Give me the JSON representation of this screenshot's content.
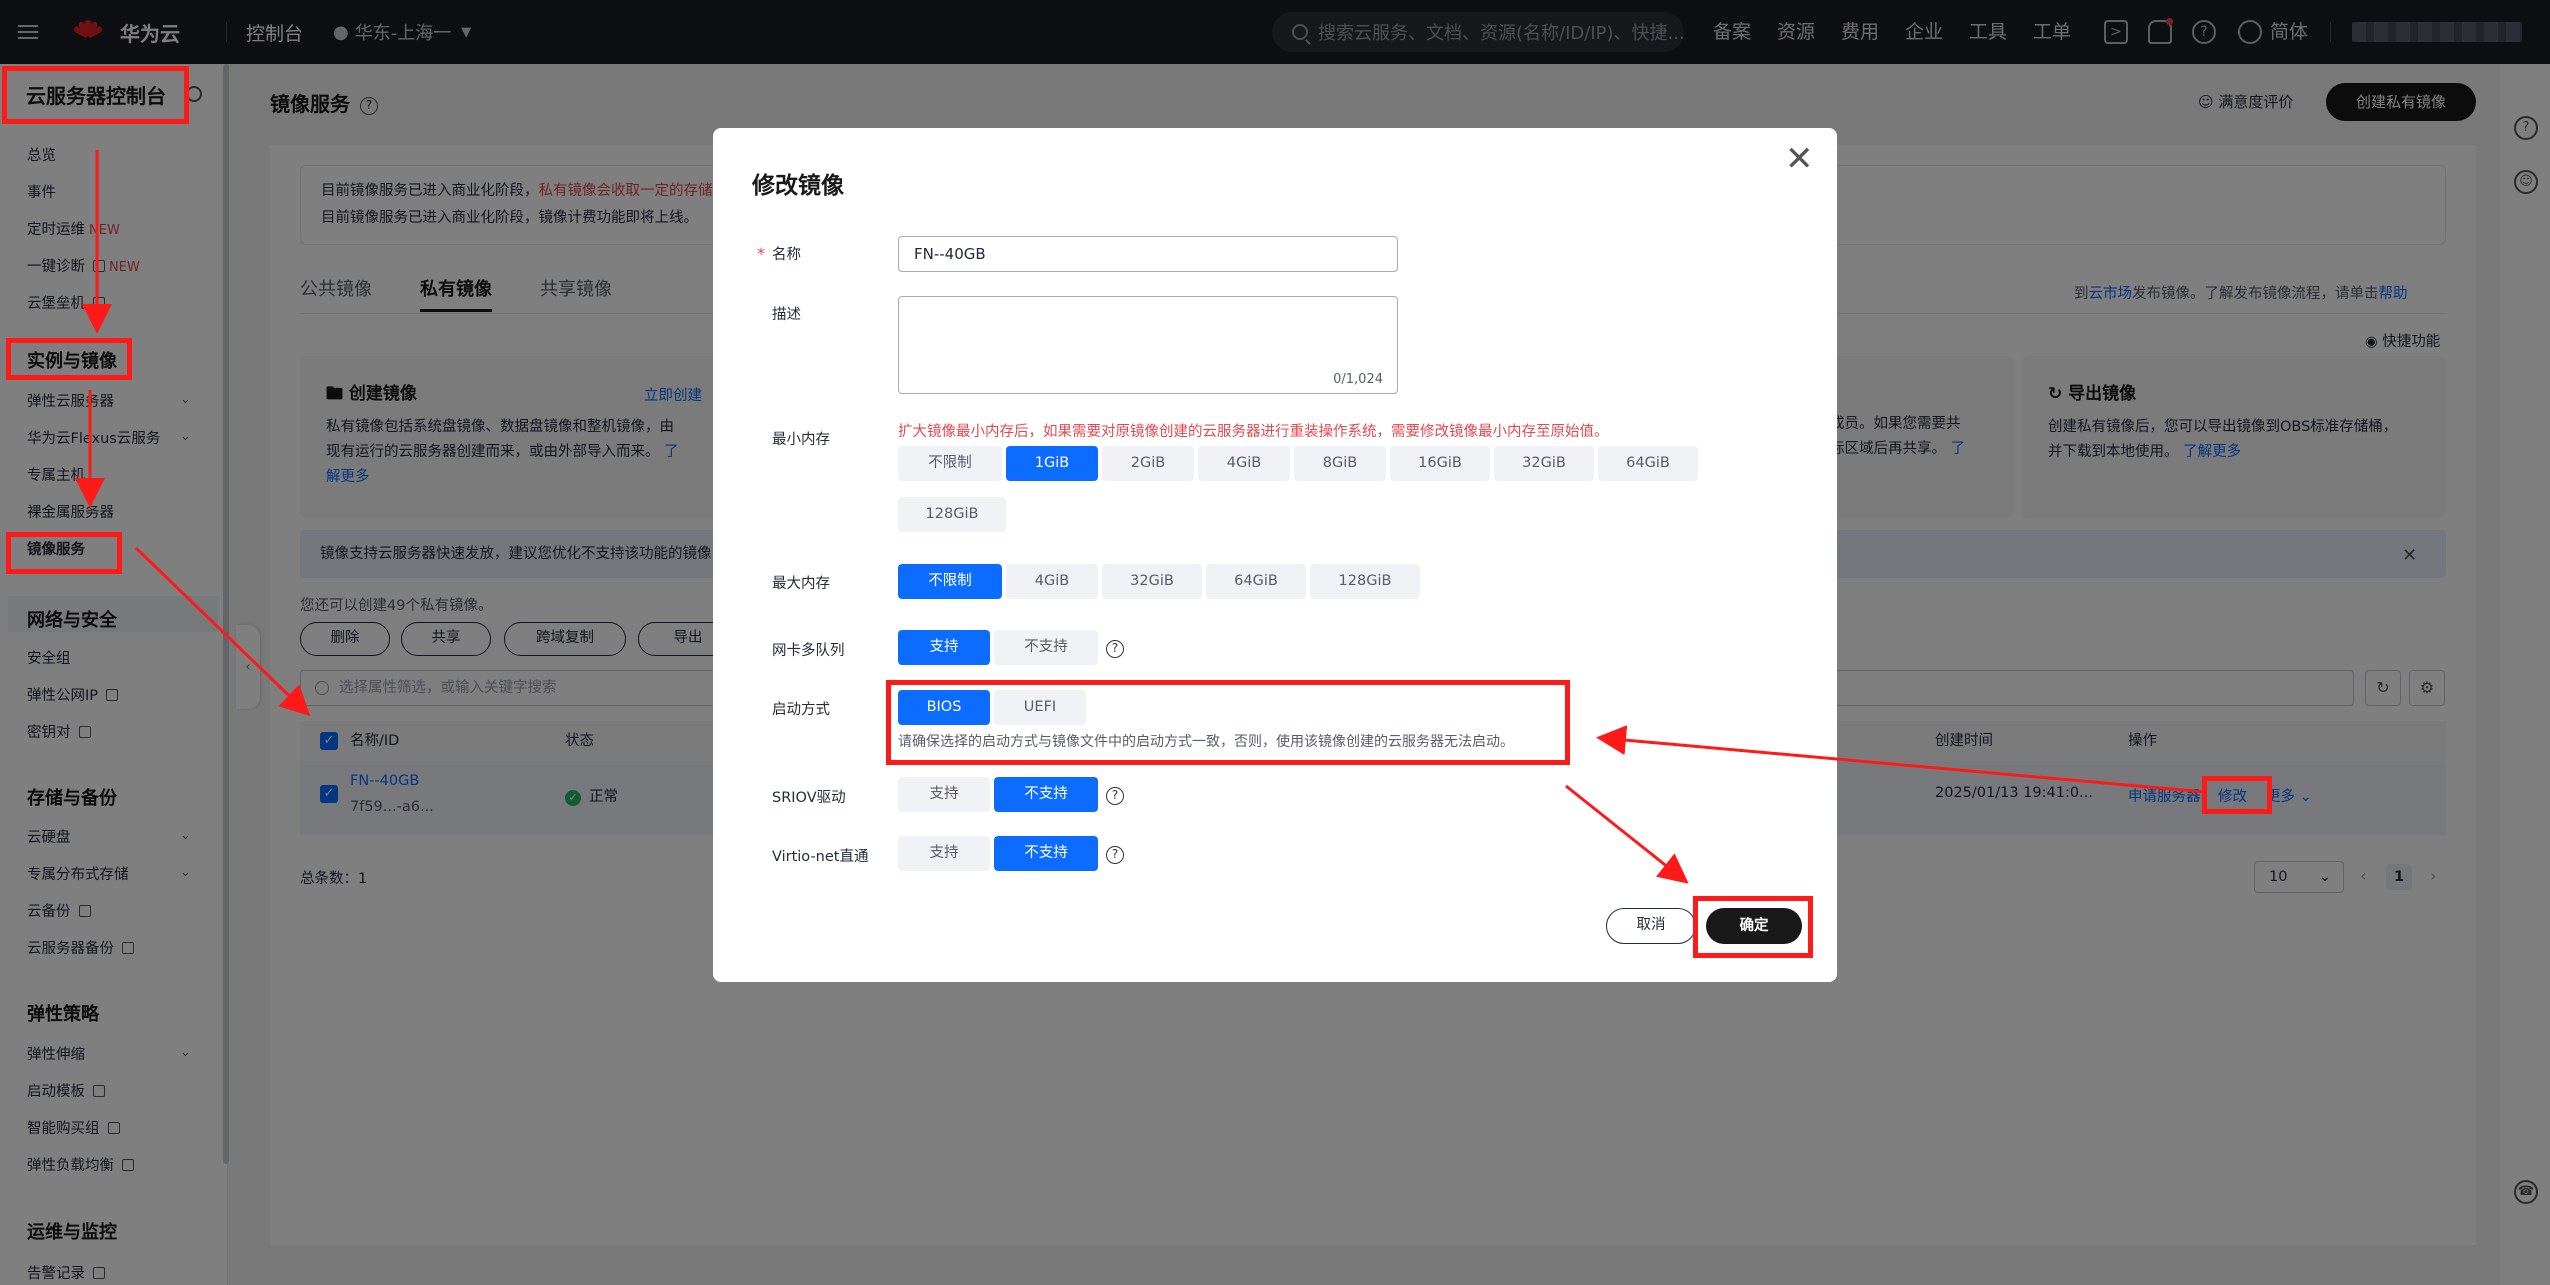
{
  "topbar": {
    "brand": "华为云",
    "console": "控制台",
    "region": "华东-上海一",
    "search_placeholder": "搜索云服务、文档、资源(名称/ID/IP)、快捷...",
    "nav": [
      "备案",
      "资源",
      "费用",
      "企业",
      "工具",
      "工单"
    ],
    "lang": "简体"
  },
  "sidebar": {
    "title": "云服务器控制台",
    "items_top": [
      {
        "label": "总览"
      },
      {
        "label": "事件"
      },
      {
        "label": "定时运维",
        "badge": "NEW"
      },
      {
        "label": "一键诊断",
        "badge": "NEW"
      },
      {
        "label": "云堡垒机"
      }
    ],
    "groups": [
      {
        "title": "实例与镜像",
        "items": [
          "弹性云服务器",
          "华为云Flexus云服务",
          "专属主机",
          "裸金属服务器",
          "镜像服务"
        ]
      },
      {
        "title": "网络与安全",
        "items": [
          "安全组",
          "弹性公网IP",
          "密钥对"
        ]
      },
      {
        "title": "存储与备份",
        "items": [
          "云硬盘",
          "专属分布式存储",
          "云备份",
          "云服务器备份"
        ]
      },
      {
        "title": "弹性策略",
        "items": [
          "弹性伸缩",
          "启动模板",
          "智能购买组",
          "弹性负载均衡"
        ]
      },
      {
        "title": "运维与监控",
        "items": [
          "告警记录"
        ]
      }
    ]
  },
  "page": {
    "title": "镜像服务",
    "survey": "满意度评价",
    "create_button": "创建私有镜像",
    "notice_line1_a": "目前镜像服务已进入商业化阶段，",
    "notice_line1_b": "私有镜像会收取一定的存储",
    "notice_line2": "目前镜像服务已进入商业化阶段，镜像计费功能即将上线。",
    "tabs": [
      "公共镜像",
      "私有镜像",
      "共享镜像"
    ],
    "tabs_right_a": "到",
    "tabs_right_link": "云市场",
    "tabs_right_b": "发布镜像。了解发布镜像流程，请单击",
    "tabs_right_help": "帮助",
    "quick": "快捷功能",
    "card_create": {
      "title": "创建镜像",
      "link": "立即创建",
      "text1": "私有镜像包括系统盘镜像、数据盘镜像和整机镜像，由",
      "text2": "现有运行的云服务器创建而来，或由外部导入而来。",
      "text3": "解更多",
      "link2": "了"
    },
    "card_share": {
      "text1": "成员。如果您需要共",
      "text2": "标区域后再共享。",
      "link": "了"
    },
    "card_export": {
      "title": "导出镜像",
      "text1": "创建私有镜像后，您可以导出镜像到OBS标准存储桶，",
      "text2": "并下载到本地使用。",
      "link": "了解更多"
    },
    "info_bar": "镜像支持云服务器快速发放，建议您优化不支持该功能的镜像",
    "quota": "您还可以创建49个私有镜像。",
    "actions": [
      "删除",
      "共享",
      "跨域复制",
      "导出"
    ],
    "filter_placeholder": "选择属性筛选，或输入关键字搜索",
    "columns": {
      "name": "名称/ID",
      "status": "状态",
      "created": "创建时间",
      "ops": "操作"
    },
    "row": {
      "name": "FN--40GB",
      "id": "7f59...-a6...",
      "status": "正常",
      "created": "2025/01/13 19:41:0...",
      "op_apply": "申请服务器",
      "op_modify": "修改",
      "op_more": "更多"
    },
    "total": "总条数：1",
    "page_size": "10",
    "page_num": "1"
  },
  "modal": {
    "title": "修改镜像",
    "name_label": "名称",
    "name_value": "FN--40GB",
    "desc_label": "描述",
    "desc_count": "0/1,024",
    "min_mem_label": "最小内存",
    "min_mem_warning": "扩大镜像最小内存后，如果需要对原镜像创建的云服务器进行重装操作系统，需要修改镜像最小内存至原始值。",
    "min_mem_options": [
      "不限制",
      "1GiB",
      "2GiB",
      "4GiB",
      "8GiB",
      "16GiB",
      "32GiB",
      "64GiB",
      "128GiB"
    ],
    "min_mem_selected": "1GiB",
    "max_mem_label": "最大内存",
    "max_mem_options": [
      "不限制",
      "4GiB",
      "32GiB",
      "64GiB",
      "128GiB"
    ],
    "max_mem_selected": "不限制",
    "nic_label": "网卡多队列",
    "nic_options": [
      "支持",
      "不支持"
    ],
    "nic_selected": "支持",
    "boot_label": "启动方式",
    "boot_options": [
      "BIOS",
      "UEFI"
    ],
    "boot_selected": "BIOS",
    "boot_hint": "请确保选择的启动方式与镜像文件中的启动方式一致，否则，使用该镜像创建的云服务器无法启动。",
    "sriov_label": "SRIOV驱动",
    "sriov_options": [
      "支持",
      "不支持"
    ],
    "sriov_selected": "不支持",
    "virtio_label": "Virtio-net直通",
    "virtio_options": [
      "支持",
      "不支持"
    ],
    "virtio_selected": "不支持",
    "cancel": "取消",
    "ok": "确定"
  },
  "colors": {
    "primary": "#0b6cff",
    "annotation": "#ff1a1a",
    "dark": "#191919",
    "topbar": "#1d1e26"
  }
}
